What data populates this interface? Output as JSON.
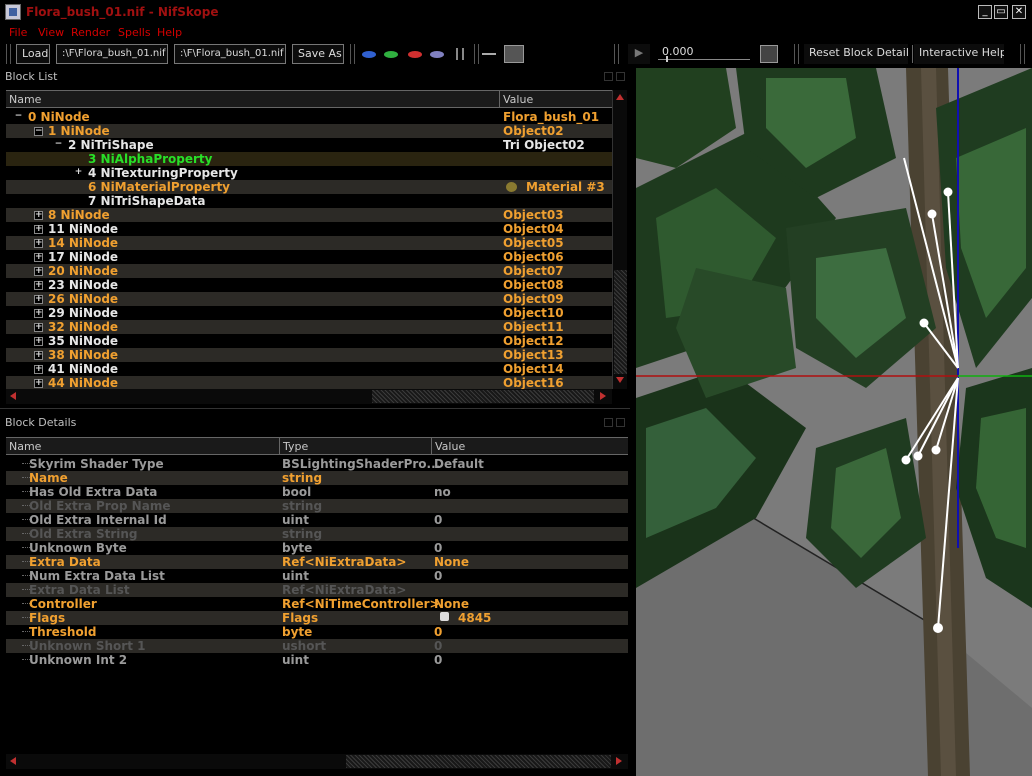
{
  "window": {
    "title": "Flora_bush_01.nif - NifSkope",
    "minimize": "_",
    "maximize": "▭",
    "close": "✕"
  },
  "menu": [
    "File",
    "View",
    "Render",
    "Spells",
    "Help"
  ],
  "toolbar": {
    "load": "Load",
    "path1": ":\\F\\Flora_bush_01.nif",
    "path2": ":\\F\\Flora_bush_01.nif",
    "save_as": "Save As",
    "play": "▶",
    "time": "0.000",
    "reset": "Reset Block Details",
    "help": "Interactive Help"
  },
  "block_list": {
    "title": "Block List",
    "col_name": "Name",
    "col_value": "Value",
    "rows": [
      {
        "indent": 0,
        "exp": "−",
        "name": "0  NiNode",
        "value": "Flora_bush_01",
        "color": "orange",
        "vcolor": "orange",
        "band": false
      },
      {
        "indent": 1,
        "exp": "−",
        "name": "1  NiNode",
        "value": "Object02",
        "color": "orange",
        "vcolor": "orange",
        "band": true
      },
      {
        "indent": 2,
        "exp": "−",
        "name": "2  NiTriShape",
        "value": "Tri Object02",
        "color": "white",
        "vcolor": "white",
        "band": false
      },
      {
        "indent": 3,
        "exp": "",
        "name": "3  NiAlphaProperty",
        "value": "",
        "color": "green",
        "vcolor": "orange",
        "band": true,
        "highlight": true
      },
      {
        "indent": 3,
        "exp": "+",
        "name": "4  NiTexturingProperty",
        "value": "",
        "color": "white",
        "vcolor": "white",
        "band": false
      },
      {
        "indent": 3,
        "exp": "",
        "name": "6  NiMaterialProperty",
        "value": "Material #3",
        "color": "orange",
        "vcolor": "orange",
        "band": true,
        "icon": true
      },
      {
        "indent": 3,
        "exp": "",
        "name": "7  NiTriShapeData",
        "value": "",
        "color": "white",
        "vcolor": "white",
        "band": false
      },
      {
        "indent": 1,
        "exp": "+",
        "name": "8  NiNode",
        "value": "Object03",
        "color": "orange",
        "vcolor": "orange",
        "band": true
      },
      {
        "indent": 1,
        "exp": "+",
        "name": "11  NiNode",
        "value": "Object04",
        "color": "white",
        "vcolor": "orange",
        "band": false
      },
      {
        "indent": 1,
        "exp": "+",
        "name": "14  NiNode",
        "value": "Object05",
        "color": "orange",
        "vcolor": "orange",
        "band": true
      },
      {
        "indent": 1,
        "exp": "+",
        "name": "17  NiNode",
        "value": "Object06",
        "color": "white",
        "vcolor": "orange",
        "band": false
      },
      {
        "indent": 1,
        "exp": "+",
        "name": "20  NiNode",
        "value": "Object07",
        "color": "orange",
        "vcolor": "orange",
        "band": true
      },
      {
        "indent": 1,
        "exp": "+",
        "name": "23  NiNode",
        "value": "Object08",
        "color": "white",
        "vcolor": "orange",
        "band": false
      },
      {
        "indent": 1,
        "exp": "+",
        "name": "26  NiNode",
        "value": "Object09",
        "color": "orange",
        "vcolor": "orange",
        "band": true
      },
      {
        "indent": 1,
        "exp": "+",
        "name": "29  NiNode",
        "value": "Object10",
        "color": "white",
        "vcolor": "orange",
        "band": false
      },
      {
        "indent": 1,
        "exp": "+",
        "name": "32  NiNode",
        "value": "Object11",
        "color": "orange",
        "vcolor": "orange",
        "band": true
      },
      {
        "indent": 1,
        "exp": "+",
        "name": "35  NiNode",
        "value": "Object12",
        "color": "white",
        "vcolor": "orange",
        "band": false
      },
      {
        "indent": 1,
        "exp": "+",
        "name": "38  NiNode",
        "value": "Object13",
        "color": "orange",
        "vcolor": "orange",
        "band": true
      },
      {
        "indent": 1,
        "exp": "+",
        "name": "41  NiNode",
        "value": "Object14",
        "color": "white",
        "vcolor": "orange",
        "band": false
      },
      {
        "indent": 1,
        "exp": "+",
        "name": "44  NiNode",
        "value": "Object16",
        "color": "orange",
        "vcolor": "orange",
        "band": true
      }
    ]
  },
  "block_details": {
    "title": "Block Details",
    "col_name": "Name",
    "col_type": "Type",
    "col_value": "Value",
    "rows": [
      {
        "name": "Skyrim Shader Type",
        "type": "BSLightingShaderPro...",
        "value": "Default",
        "style": "gray",
        "band": false
      },
      {
        "name": "Name",
        "type": "string",
        "value": "",
        "style": "orange",
        "band": true
      },
      {
        "name": "Has Old Extra Data",
        "type": "bool",
        "value": "no",
        "style": "gray",
        "band": false
      },
      {
        "name": "Old Extra Prop Name",
        "type": "string",
        "value": "",
        "style": "dim",
        "band": true
      },
      {
        "name": "Old Extra Internal Id",
        "type": "uint",
        "value": "0",
        "style": "gray",
        "band": false
      },
      {
        "name": "Old Extra String",
        "type": "string",
        "value": "",
        "style": "dim",
        "band": true
      },
      {
        "name": "Unknown Byte",
        "type": "byte",
        "value": "0",
        "style": "gray",
        "band": false
      },
      {
        "name": "Extra Data",
        "type": "Ref<NiExtraData>",
        "value": "None",
        "style": "orange",
        "band": true
      },
      {
        "name": "Num Extra Data List",
        "type": "uint",
        "value": "0",
        "style": "gray",
        "band": false
      },
      {
        "name": "Extra Data List",
        "type": "Ref<NiExtraData>",
        "value": "",
        "style": "dim",
        "band": true
      },
      {
        "name": "Controller",
        "type": "Ref<NiTimeController>",
        "value": "None",
        "style": "orange",
        "band": false
      },
      {
        "name": "Flags",
        "type": "Flags",
        "value": "4845",
        "style": "orange",
        "band": true,
        "icon": true
      },
      {
        "name": "Threshold",
        "type": "byte",
        "value": "0",
        "style": "orange",
        "band": false
      },
      {
        "name": "Unknown Short 1",
        "type": "ushort",
        "value": "0",
        "style": "dim",
        "band": true
      },
      {
        "name": "Unknown Int 2",
        "type": "uint",
        "value": "0",
        "style": "gray",
        "band": false
      }
    ]
  },
  "colors": {
    "menu": "#d40000",
    "accent_orange": "#f0a030",
    "selected_green": "#28e028",
    "band": "#2c2a26"
  }
}
